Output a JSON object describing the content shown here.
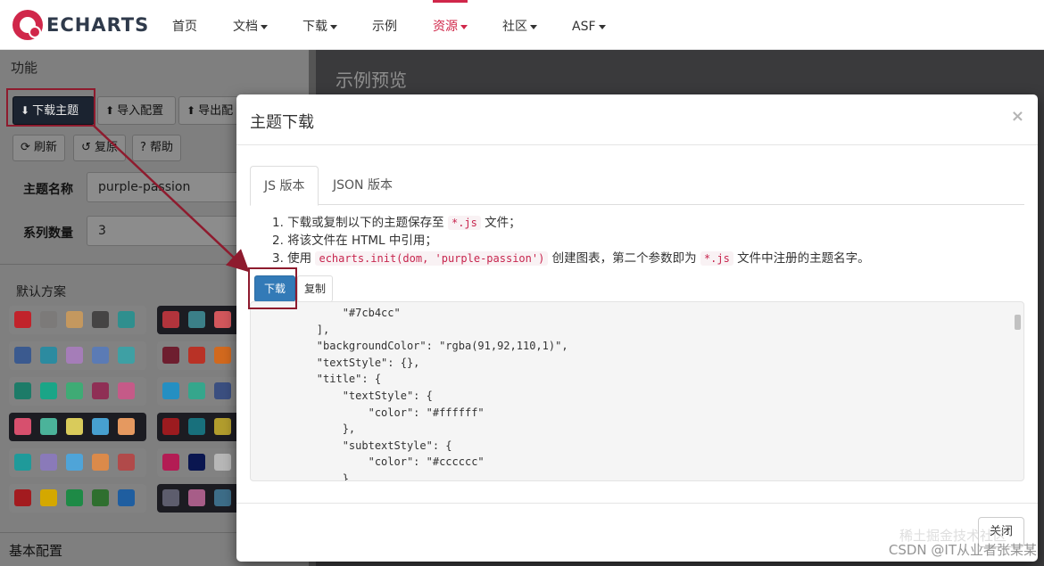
{
  "nav": {
    "logo_text": "ECHARTS",
    "items": [
      {
        "label": "首页",
        "has_caret": false
      },
      {
        "label": "文档",
        "has_caret": true
      },
      {
        "label": "下载",
        "has_caret": true
      },
      {
        "label": "示例",
        "has_caret": false
      },
      {
        "label": "资源",
        "has_caret": true,
        "active": true
      },
      {
        "label": "社区",
        "has_caret": true
      },
      {
        "label": "ASF",
        "has_caret": true
      }
    ],
    "accent_color": "#d0274a"
  },
  "left_panel": {
    "title": "功能",
    "buttons": {
      "download_theme": "下载主题",
      "import_config": "导入配置",
      "export_config": "导出配",
      "refresh": "刷新",
      "reset": "复原",
      "help": "帮助"
    },
    "fields": {
      "theme_name_label": "主题名称",
      "theme_name_value": "purple-passion",
      "series_count_label": "系列数量",
      "series_count_value": "3"
    },
    "default_scheme_label": "默认方案",
    "bottom_section": "基本配置",
    "swatch_rows_left": [
      [
        "#c1232b",
        "#7c7a79",
        "#c4985f",
        "#454444",
        "#2f8f8e"
      ],
      [
        "#3b5a8f",
        "#2c8ba0",
        "#a57db8",
        "#5b7bb5",
        "#3ea0a4"
      ],
      [
        "#1d7b68",
        "#1aa587",
        "#3fab75",
        "#8f2f55",
        "#c55a88"
      ],
      [
        "#d7506e",
        "#4bb39a",
        "#d9cb5b",
        "#47a0d0",
        "#e59960"
      ],
      [
        "#1f9a9a",
        "#8a7ab9",
        "#4fa4d8",
        "#db8a4a",
        "#b14a4a"
      ],
      [
        "#a31b1f",
        "#d4a800",
        "#1e8a46",
        "#2f6f2f",
        "#1f5ea0"
      ]
    ],
    "swatch_rows_right": [
      [
        "#b2343c",
        "#3b7f88",
        "#d2575c",
        "#a04548",
        "#4b8a8f"
      ],
      [
        "#6e1e2f",
        "#b93226",
        "#d2691e",
        "#8a2c2c",
        "#9f6a2c"
      ],
      [
        "#258fc2",
        "#35a68c",
        "#3b4f80",
        "#6a6a94",
        "#7e7e7e"
      ],
      [
        "#9c1b1f",
        "#18707c",
        "#b29d2d",
        "#1c1c22",
        "#1c1c22"
      ],
      [
        "#b31c54",
        "#0a1650",
        "#b7b7b7",
        "#7f7f7f",
        "#7f7f7f"
      ],
      [
        "#5d5d6d",
        "#a75d88",
        "#3d6d88",
        "#7f7f7f",
        "#7f7f7f"
      ]
    ],
    "dark_rows_right": [
      0,
      3,
      5
    ],
    "dark_rows_left": [
      3
    ]
  },
  "preview": {
    "title": "示例预览"
  },
  "modal": {
    "title": "主题下载",
    "close_icon": "×",
    "tabs": [
      {
        "label": "JS 版本",
        "active": true
      },
      {
        "label": "JSON 版本",
        "active": false
      }
    ],
    "steps": {
      "s1_prefix": "1. 下载或复制以下的主题保存至",
      "s1_code": "*.js",
      "s1_suffix": "文件；",
      "s2": "2. 将该文件在 HTML 中引用；",
      "s3_prefix": "3. 使用",
      "s3_code": "echarts.init(dom, 'purple-passion')",
      "s3_mid": "创建图表，第二个参数即为",
      "s3_code2": "*.js",
      "s3_suffix": "文件中注册的主题名字。"
    },
    "download_button": "下载",
    "copy_button": "复制",
    "code_lines": [
      "            \"#7cb4cc\"",
      "        ],",
      "        \"backgroundColor\": \"rgba(91,92,110,1)\",",
      "        \"textStyle\": {},",
      "        \"title\": {",
      "            \"textStyle\": {",
      "                \"color\": \"#ffffff\"",
      "            },",
      "            \"subtextStyle\": {",
      "                \"color\": \"#cccccc\"",
      "            }"
    ],
    "close_button": "关闭"
  },
  "watermark": {
    "line1": "稀土掘金技术社区",
    "line2": "CSDN @IT从业者张某某"
  }
}
